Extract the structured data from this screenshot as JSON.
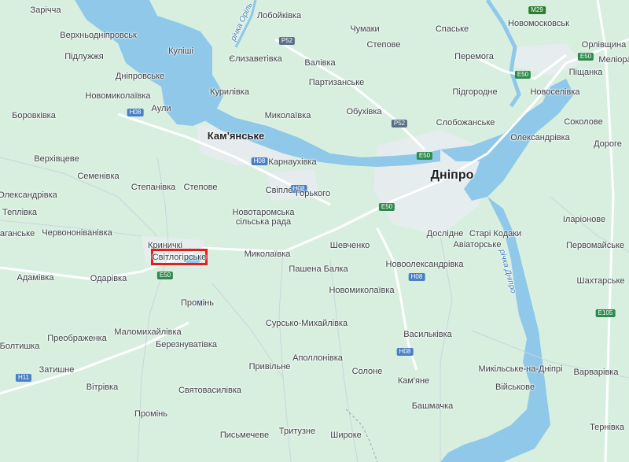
{
  "map": {
    "colors": {
      "land": "#d8efe0",
      "water": "#8fc8e8",
      "urban": "#eceff1",
      "road": "#ffffff",
      "highlight": "#e0201b"
    },
    "highlight_label": "Світлогірське",
    "cities": {
      "kamianske": "Кам'янське",
      "dnipro": "Дніпро"
    },
    "places": [
      "Зарічча",
      "Верхньодніпровськ",
      "Підлужжя",
      "Дніпровське",
      "Новомиколаївка",
      "Аули",
      "Боровківка",
      "Верхівцеве",
      "Семенівка",
      "Олександрівка",
      "Теплівка",
      "Саганське",
      "Червононіванівка",
      "Адамівка",
      "Криничкі",
      "Одарівка",
      "Степанівка",
      "Степове",
      "Куліші",
      "Лобойківка",
      "Єлизаветівка",
      "Валівка",
      "Курилівка",
      "Миколаївка",
      "Партизанське",
      "Обухівка",
      "Чумаки",
      "Степове",
      "Спаське",
      "Перемога",
      "Підгородне",
      "Слобожанське",
      "Новомосковськ",
      "Орлівщина",
      "Меліорати",
      "Піщанка",
      "Новоселівка",
      "Соколове",
      "Олександрівка",
      "Дороге",
      "Карнаухівка",
      "Свіпле",
      "Горького",
      "Новотаромська сільська рада",
      "Миколаївка",
      "Шевченко",
      "Пашена Балка",
      "Новоолександрівка",
      "Новомиколаївка",
      "Дослідне",
      "Старі Кодаки",
      "Авіаторське",
      "Іларіонове",
      "Первомайське",
      "Шахтарське",
      "Промінь",
      "Сурсько-Михайлівка",
      "Маломихайлівка",
      "Преображенка",
      "Березнуватівка",
      "Болтишка",
      "Затишне",
      "Вітрівка",
      "Святовасилівка",
      "Промінь",
      "Привільне",
      "Аполлонівка",
      "Солоне",
      "Васильківка",
      "Кам'яне",
      "Башмачка",
      "Письмечеве",
      "Тритузне",
      "Широке",
      "Микільське-на-Дніпрі",
      "Військове",
      "Варварівка",
      "Тернівка"
    ],
    "rivers": [
      "річка Оріль",
      "річка Дніпро"
    ],
    "shields": [
      "P52",
      "P52",
      "H08",
      "H08",
      "H08",
      "H08",
      "H08",
      "H08",
      "E50",
      "E50",
      "E50",
      "E50",
      "E50",
      "E105",
      "M29",
      "H11"
    ]
  }
}
